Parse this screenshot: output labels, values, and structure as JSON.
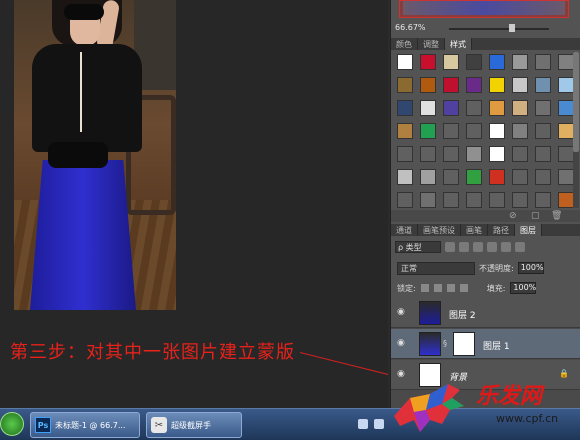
{
  "canvas": {
    "step_caption": "第三步：对其中一张图片建立蒙版"
  },
  "navigator": {
    "zoom": "66.67%"
  },
  "styles_panel": {
    "tabs": [
      {
        "label": "颜色",
        "active": false
      },
      {
        "label": "调整",
        "active": false
      },
      {
        "label": "样式",
        "active": true
      }
    ],
    "swatches": [
      "#ffffff",
      "#c8102e",
      "#d8c8a0",
      "#404040",
      "#2a6ad8",
      "#9a9a9a",
      "#707070",
      "#808080",
      "#8a6a30",
      "#b05a10",
      "#c01030",
      "#6a2a8a",
      "#f2d200",
      "#c8c8c8",
      "#7090b0",
      "#a0c8e8",
      "#304870",
      "#e0e0e0",
      "#5040a0",
      "#606060",
      "#e09a40",
      "#d0b080",
      "#707070",
      "#4a8ad0",
      "#b08040",
      "#20a050",
      "#606060",
      "#606060",
      "#ffffff",
      "#808080",
      "#606060",
      "#e0b060",
      "#606060",
      "#606060",
      "#606060",
      "#909090",
      "#ffffff",
      "#606060",
      "#606060",
      "#606060",
      "#c0c0c0",
      "#a0a0a0",
      "#606060",
      "#30a040",
      "#d03020",
      "#606060",
      "#606060",
      "#707070",
      "#606060",
      "#707070",
      "#606060",
      "#606060",
      "#606060",
      "#606060",
      "#606060",
      "#c06020"
    ]
  },
  "layers_panel": {
    "tabs": [
      {
        "label": "通道",
        "active": false
      },
      {
        "label": "画笔预设",
        "active": false
      },
      {
        "label": "画笔",
        "active": false
      },
      {
        "label": "路径",
        "active": false
      },
      {
        "label": "图层",
        "active": true
      }
    ],
    "kind_filter": "ρ 类型",
    "blend_mode": "正常",
    "opacity_label": "不透明度:",
    "opacity_value": "100%",
    "lock_label": "锁定:",
    "fill_label": "填充:",
    "fill_value": "100%",
    "layers": [
      {
        "name": "图层 2",
        "selected": false,
        "has_mask": false,
        "locked": false
      },
      {
        "name": "图层 1",
        "selected": true,
        "has_mask": true,
        "locked": false
      },
      {
        "name": "背景",
        "selected": false,
        "has_mask": false,
        "locked": true
      }
    ]
  },
  "taskbar": {
    "items": [
      {
        "icon": "photoshop-icon",
        "label": "未标题-1 @ 66.7..."
      },
      {
        "icon": "scissors-icon",
        "label": "超级截屏手"
      }
    ]
  },
  "watermark": {
    "brand": "乐发网",
    "url": "www.cpf.cn"
  }
}
